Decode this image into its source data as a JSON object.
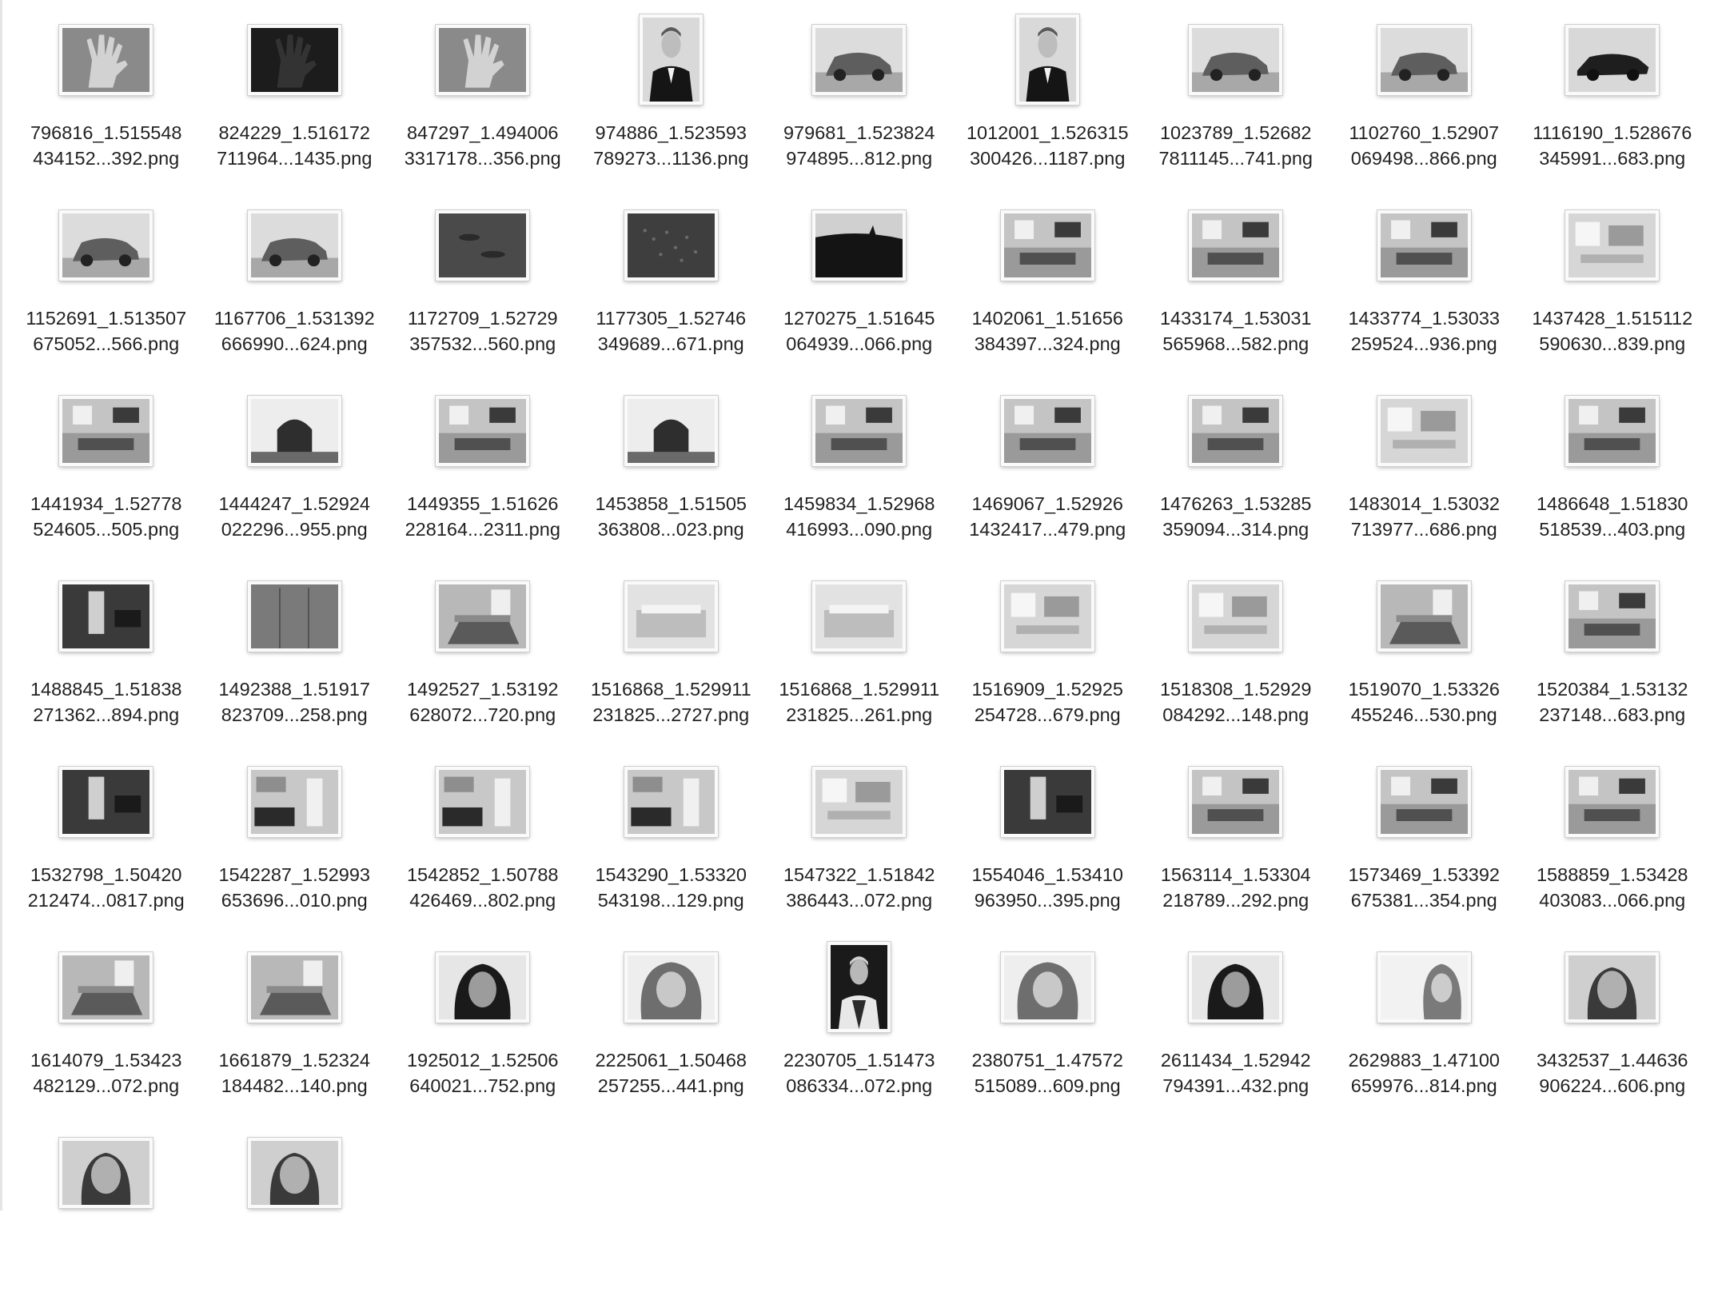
{
  "files": [
    {
      "line1": "796816_1.515548",
      "line2": "434152...392.png",
      "shape": "land",
      "scene": "hand"
    },
    {
      "line1": "824229_1.516172",
      "line2": "711964...1435.png",
      "shape": "land",
      "scene": "hand-dark"
    },
    {
      "line1": "847297_1.494006",
      "line2": "3317178...356.png",
      "shape": "land",
      "scene": "hand"
    },
    {
      "line1": "974886_1.523593",
      "line2": "789273...1136.png",
      "shape": "port",
      "scene": "portrait-suit"
    },
    {
      "line1": "979681_1.523824",
      "line2": "974895...812.png",
      "shape": "land",
      "scene": "car"
    },
    {
      "line1": "1012001_1.526315",
      "line2": "300426...1187.png",
      "shape": "port",
      "scene": "portrait-suit"
    },
    {
      "line1": "1023789_1.52682",
      "line2": "7811145...741.png",
      "shape": "land",
      "scene": "car"
    },
    {
      "line1": "1102760_1.52907",
      "line2": "069498...866.png",
      "shape": "land",
      "scene": "car"
    },
    {
      "line1": "1116190_1.528676",
      "line2": "345991...683.png",
      "shape": "land",
      "scene": "car-dark"
    },
    {
      "line1": "1152691_1.513507",
      "line2": "675052...566.png",
      "shape": "land",
      "scene": "car"
    },
    {
      "line1": "1167706_1.531392",
      "line2": "666990...624.png",
      "shape": "land",
      "scene": "car"
    },
    {
      "line1": "1172709_1.52729",
      "line2": "357532...560.png",
      "shape": "land",
      "scene": "water"
    },
    {
      "line1": "1177305_1.52746",
      "line2": "349689...671.png",
      "shape": "land",
      "scene": "water-fish"
    },
    {
      "line1": "1270275_1.51645",
      "line2": "064939...066.png",
      "shape": "land",
      "scene": "water-wave"
    },
    {
      "line1": "1402061_1.51656",
      "line2": "384397...324.png",
      "shape": "land",
      "scene": "room"
    },
    {
      "line1": "1433174_1.53031",
      "line2": "565968...582.png",
      "shape": "land",
      "scene": "room"
    },
    {
      "line1": "1433774_1.53033",
      "line2": "259524...936.png",
      "shape": "land",
      "scene": "room"
    },
    {
      "line1": "1437428_1.515112",
      "line2": "590630...839.png",
      "shape": "land",
      "scene": "room-light"
    },
    {
      "line1": "1441934_1.52778",
      "line2": "524605...505.png",
      "shape": "land",
      "scene": "room"
    },
    {
      "line1": "1444247_1.52924",
      "line2": "022296...955.png",
      "shape": "land",
      "scene": "arch"
    },
    {
      "line1": "1449355_1.51626",
      "line2": "228164...2311.png",
      "shape": "land",
      "scene": "room"
    },
    {
      "line1": "1453858_1.51505",
      "line2": "363808...023.png",
      "shape": "land",
      "scene": "arch"
    },
    {
      "line1": "1459834_1.52968",
      "line2": "416993...090.png",
      "shape": "land",
      "scene": "room"
    },
    {
      "line1": "1469067_1.52926",
      "line2": "1432417...479.png",
      "shape": "land",
      "scene": "room"
    },
    {
      "line1": "1476263_1.53285",
      "line2": "359094...314.png",
      "shape": "land",
      "scene": "room"
    },
    {
      "line1": "1483014_1.53032",
      "line2": "713977...686.png",
      "shape": "land",
      "scene": "room-light"
    },
    {
      "line1": "1486648_1.51830",
      "line2": "518539...403.png",
      "shape": "land",
      "scene": "room"
    },
    {
      "line1": "1488845_1.51838",
      "line2": "271362...894.png",
      "shape": "land",
      "scene": "room-dark"
    },
    {
      "line1": "1492388_1.51917",
      "line2": "823709...258.png",
      "shape": "land",
      "scene": "closet"
    },
    {
      "line1": "1492527_1.53192",
      "line2": "628072...720.png",
      "shape": "land",
      "scene": "bedroom"
    },
    {
      "line1": "1516868_1.529911",
      "line2": "231825...2727.png",
      "shape": "land",
      "scene": "bedroom-light"
    },
    {
      "line1": "1516868_1.529911",
      "line2": "231825...261.png",
      "shape": "land",
      "scene": "bedroom-light"
    },
    {
      "line1": "1516909_1.52925",
      "line2": "254728...679.png",
      "shape": "land",
      "scene": "room-light"
    },
    {
      "line1": "1518308_1.52929",
      "line2": "084292...148.png",
      "shape": "land",
      "scene": "room-light"
    },
    {
      "line1": "1519070_1.53326",
      "line2": "455246...530.png",
      "shape": "land",
      "scene": "bedroom"
    },
    {
      "line1": "1520384_1.53132",
      "line2": "237148...683.png",
      "shape": "land",
      "scene": "room"
    },
    {
      "line1": "1532798_1.50420",
      "line2": "212474...0817.png",
      "shape": "land",
      "scene": "room-dark"
    },
    {
      "line1": "1542287_1.52993",
      "line2": "653696...010.png",
      "shape": "land",
      "scene": "kitchen"
    },
    {
      "line1": "1542852_1.50788",
      "line2": "426469...802.png",
      "shape": "land",
      "scene": "kitchen"
    },
    {
      "line1": "1543290_1.53320",
      "line2": "543198...129.png",
      "shape": "land",
      "scene": "kitchen"
    },
    {
      "line1": "1547322_1.51842",
      "line2": "386443...072.png",
      "shape": "land",
      "scene": "room-light"
    },
    {
      "line1": "1554046_1.53410",
      "line2": "963950...395.png",
      "shape": "land",
      "scene": "room-dark"
    },
    {
      "line1": "1563114_1.53304",
      "line2": "218789...292.png",
      "shape": "land",
      "scene": "room"
    },
    {
      "line1": "1573469_1.53392",
      "line2": "675381...354.png",
      "shape": "land",
      "scene": "room"
    },
    {
      "line1": "1588859_1.53428",
      "line2": "403083...066.png",
      "shape": "land",
      "scene": "room"
    },
    {
      "line1": "1614079_1.53423",
      "line2": "482129...072.png",
      "shape": "land",
      "scene": "bedroom"
    },
    {
      "line1": "1661879_1.52324",
      "line2": "184482...140.png",
      "shape": "land",
      "scene": "bedroom"
    },
    {
      "line1": "1925012_1.52506",
      "line2": "640021...752.png",
      "shape": "land",
      "scene": "face-dark"
    },
    {
      "line1": "2225061_1.50468",
      "line2": "257255...441.png",
      "shape": "land",
      "scene": "face-curly"
    },
    {
      "line1": "2230705_1.51473",
      "line2": "086334...072.png",
      "shape": "port",
      "scene": "portrait-dark"
    },
    {
      "line1": "2380751_1.47572",
      "line2": "515089...609.png",
      "shape": "land",
      "scene": "face-curly"
    },
    {
      "line1": "2611434_1.52942",
      "line2": "794391...432.png",
      "shape": "land",
      "scene": "face-dark"
    },
    {
      "line1": "2629883_1.47100",
      "line2": "659976...814.png",
      "shape": "land",
      "scene": "face-curly-light"
    },
    {
      "line1": "3432537_1.44636",
      "line2": "906224...606.png",
      "shape": "land",
      "scene": "face"
    },
    {
      "line1": "",
      "line2": "",
      "shape": "land",
      "scene": "face"
    },
    {
      "line1": "",
      "line2": "",
      "shape": "land",
      "scene": "face"
    }
  ]
}
